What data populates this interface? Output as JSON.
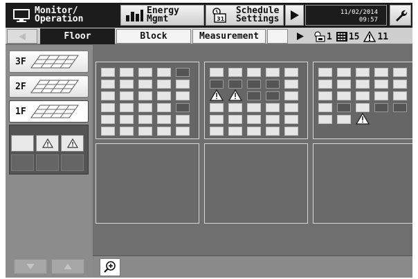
{
  "menu": {
    "monitor": "Monitor/\nOperation",
    "energy": "Energy\nMgmt",
    "schedule": "Schedule\n Settings",
    "date": "11/02/2014",
    "time": "09:57"
  },
  "tabs": {
    "floor": "Floor",
    "block": "Block",
    "measurement": "Measurement"
  },
  "status_counts": {
    "schedule": "1",
    "units": "15",
    "alarms": "11"
  },
  "floors": [
    {
      "label": "3F"
    },
    {
      "label": "2F"
    },
    {
      "label": "1F"
    }
  ],
  "groups": [
    {
      "rows": [
        [
          "u",
          "u",
          "u",
          "u",
          "d"
        ],
        [
          "u",
          "u",
          "u",
          "u",
          "u"
        ],
        [
          "u",
          "u",
          "u",
          "u",
          "u"
        ],
        [
          "u",
          "u",
          "u",
          "u",
          "d"
        ],
        [
          "u",
          "u",
          "u",
          "u",
          "u"
        ],
        [
          "u",
          "u",
          "u",
          "u",
          "u"
        ]
      ]
    },
    {
      "rows": [
        [
          "u",
          "u",
          "u",
          "u",
          "u"
        ],
        [
          "d",
          "d",
          "d",
          "d",
          "u"
        ],
        [
          "a",
          "a",
          "d",
          "d",
          "u"
        ],
        [
          "u",
          "u",
          "u",
          "u",
          "u"
        ],
        [
          "u",
          "u",
          "u",
          "u",
          "u"
        ],
        [
          "u",
          "u",
          "u",
          "u",
          "u"
        ]
      ]
    },
    {
      "rows": [
        [
          "u",
          "u",
          "u",
          "u",
          "u"
        ],
        [
          "u",
          "u",
          "u",
          "u",
          "u"
        ],
        [
          "u",
          "u",
          "u",
          "u",
          "u"
        ],
        [
          "u",
          "d",
          "u",
          "d",
          "d"
        ],
        [
          "u",
          "u",
          "a",
          "",
          ""
        ],
        [
          "",
          "",
          "",
          "",
          ""
        ]
      ]
    }
  ],
  "colors": {
    "screen_bg": "#6f6f6f",
    "bar_dark": "#1c1c1c",
    "unit_on": "#e6e6e6",
    "unit_off": "#555555"
  }
}
